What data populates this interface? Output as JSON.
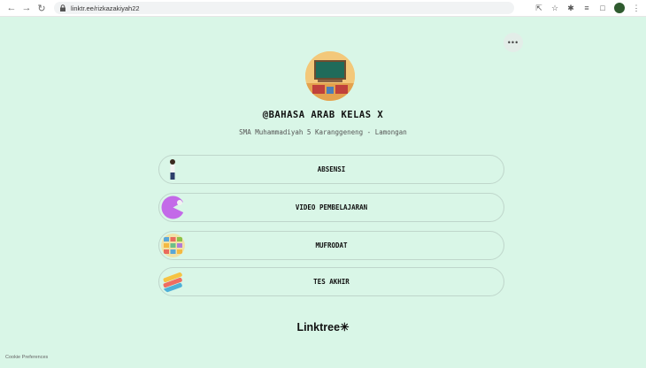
{
  "browser": {
    "url": "linktr.ee/rizkazakiyah22"
  },
  "profile": {
    "title": "@BAHASA ARAB KELAS X",
    "subtitle": "SMA Muhammadiyah 5 Karanggeneng - Lamongan"
  },
  "more_label": "•••",
  "links": [
    {
      "label": "ABSENSI"
    },
    {
      "label": "VIDEO PEMBELAJARAN"
    },
    {
      "label": "MUFRODAT"
    },
    {
      "label": "TES AKHIR"
    }
  ],
  "footer": {
    "logo": "Linktree✳",
    "cookie": "Cookie Preferences"
  },
  "colors": {
    "background": "#d9f6e7",
    "border": "#bfd6cb",
    "text": "#111111"
  }
}
